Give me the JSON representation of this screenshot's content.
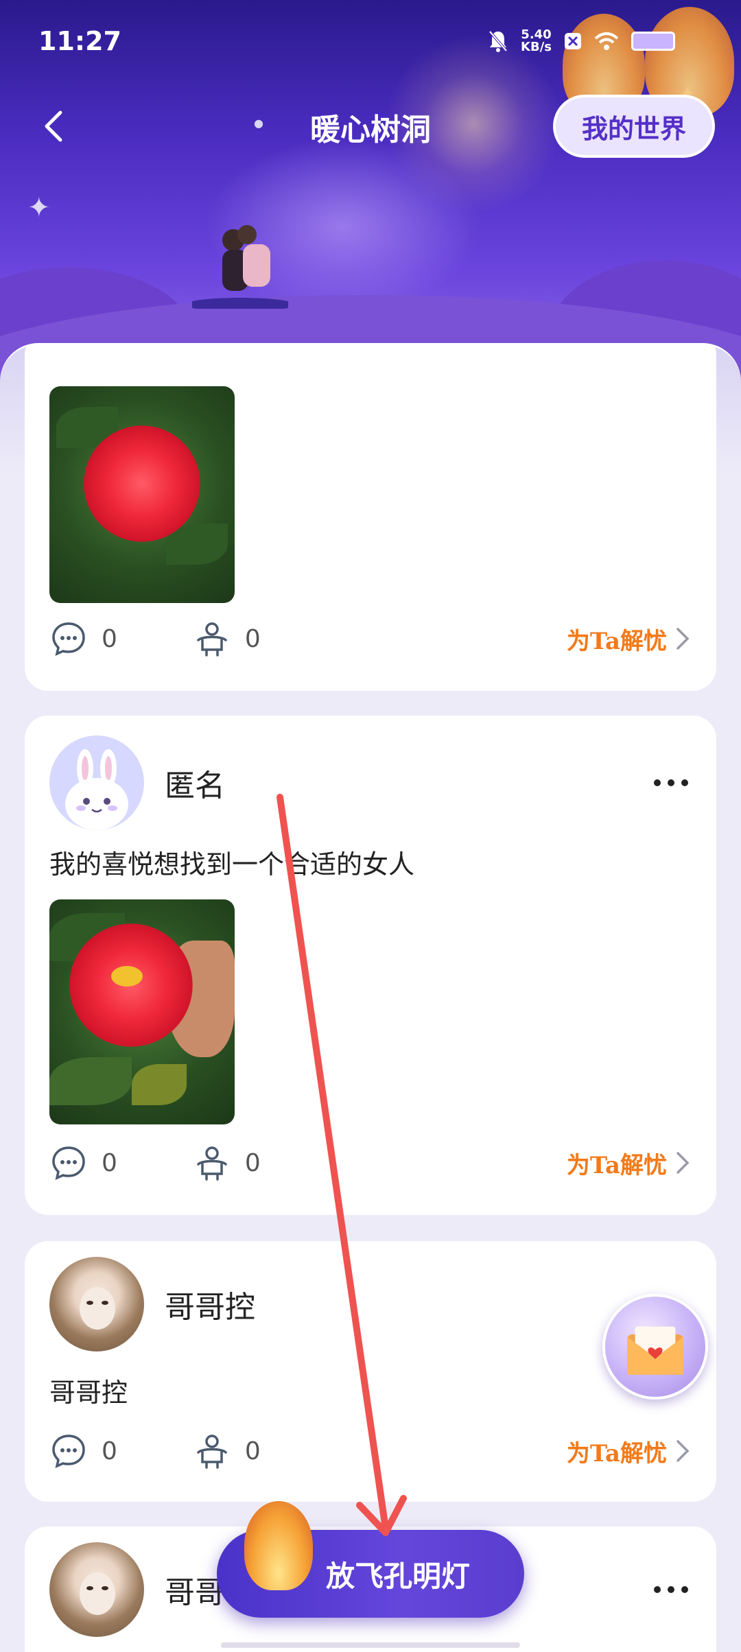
{
  "status_bar": {
    "time": "11:27",
    "net_speed_value": "5.40",
    "net_speed_unit": "KB/s"
  },
  "nav": {
    "title": "暖心树洞",
    "my_world_label": "我的世界"
  },
  "posts": [
    {
      "comments": "0",
      "hugs": "0",
      "help_label": "为Ta解忧"
    },
    {
      "username": "匿名",
      "text": "我的喜悦想找到一个合适的女人",
      "comments": "0",
      "hugs": "0",
      "help_label": "为Ta解忧"
    },
    {
      "username": "哥哥控",
      "text": "哥哥控",
      "comments": "0",
      "hugs": "0",
      "help_label": "为Ta解忧"
    },
    {
      "username": "哥哥"
    }
  ],
  "release_button_label": "放飞孔明灯",
  "colors": {
    "accent": "#5530c6",
    "help_link": "#f27a1a",
    "annotation_arrow": "#ef5350"
  }
}
